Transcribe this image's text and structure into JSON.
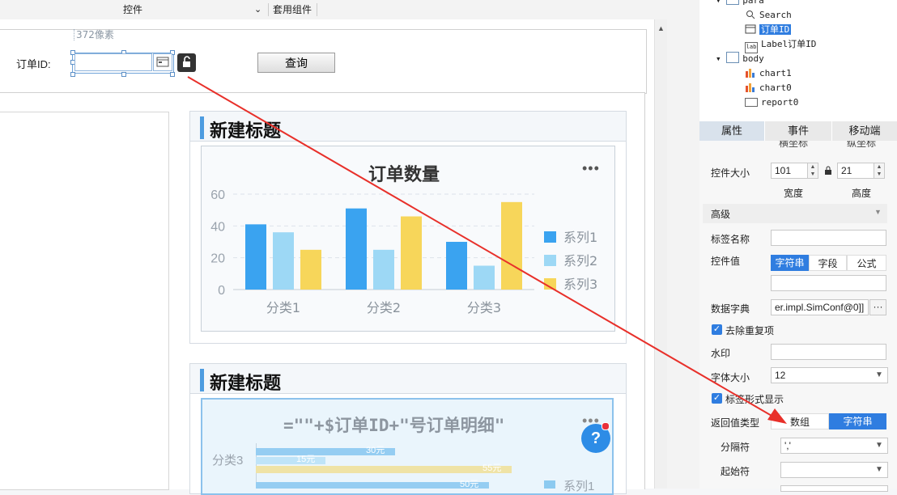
{
  "header": {
    "controls_label": "控件",
    "template_label": "套用组件",
    "chevron": "chevron-down-icon"
  },
  "para": {
    "size_hint": "372像素",
    "order_id_label": "订单ID:",
    "order_id_value": "",
    "query_button": "查询"
  },
  "widgets": [
    {
      "title": "新建标题"
    },
    {
      "title": "新建标题"
    }
  ],
  "chart_data": [
    {
      "type": "bar",
      "title": "订单数量",
      "categories": [
        "分类1",
        "分类2",
        "分类3"
      ],
      "series": [
        {
          "name": "系列1",
          "values": [
            41,
            51,
            30
          ],
          "color": "#3aa3f0"
        },
        {
          "name": "系列2",
          "values": [
            36,
            25,
            15
          ],
          "color": "#9dd8f5"
        },
        {
          "name": "系列3",
          "values": [
            25,
            46,
            55
          ],
          "color": "#f7d65a"
        }
      ],
      "ylim": [
        0,
        60
      ],
      "yticks": [
        0,
        20,
        40,
        60
      ],
      "grid": true,
      "legend": "right"
    },
    {
      "type": "bar",
      "title": "=\"\"+$订单ID+\"号订单明细\"",
      "orientation": "horizontal",
      "visible_categories": [
        "分类3"
      ],
      "data_labels": [
        "30元",
        "15元",
        "55元",
        "50元"
      ],
      "legend_visible": [
        "系列1"
      ]
    }
  ],
  "tree": {
    "items": [
      {
        "label": "para",
        "icon": "para-icon"
      },
      {
        "label": "Search",
        "icon": "search-icon"
      },
      {
        "label": "订单ID",
        "icon": "textfield-icon"
      },
      {
        "label": "Label订单ID",
        "icon": "label-icon"
      },
      {
        "label": "body",
        "icon": "body-icon"
      },
      {
        "label": "chart1",
        "icon": "chart-icon"
      },
      {
        "label": "chart0",
        "icon": "chart-icon"
      },
      {
        "label": "report0",
        "icon": "report-icon"
      }
    ]
  },
  "tabs": [
    "属性",
    "事件",
    "移动端"
  ],
  "props": {
    "cut_top_left": "横坐标",
    "cut_top_right": "纵坐标",
    "size_label": "控件大小",
    "width_value": "101",
    "height_value": "21",
    "width_label": "宽度",
    "height_label": "高度",
    "advanced": "高级",
    "label_name": "标签名称",
    "control_value": "控件值",
    "cv_opts": [
      "字符串",
      "字段",
      "公式"
    ],
    "data_dict": "数据字典",
    "data_dict_value": "er.impl.SimConf@0]]",
    "dedupe": "去除重复项",
    "watermark": "水印",
    "font_size": "字体大小",
    "font_size_value": "12",
    "tag_display": "标签形式显示",
    "return_type": "返回值类型",
    "return_opts": [
      "数组",
      "字符串"
    ],
    "separator": "分隔符",
    "separator_value": "','",
    "start_char": "起始符",
    "start_char_value": ""
  },
  "colors": {
    "accent": "#2f7de0",
    "help": "#2d8ce6"
  }
}
